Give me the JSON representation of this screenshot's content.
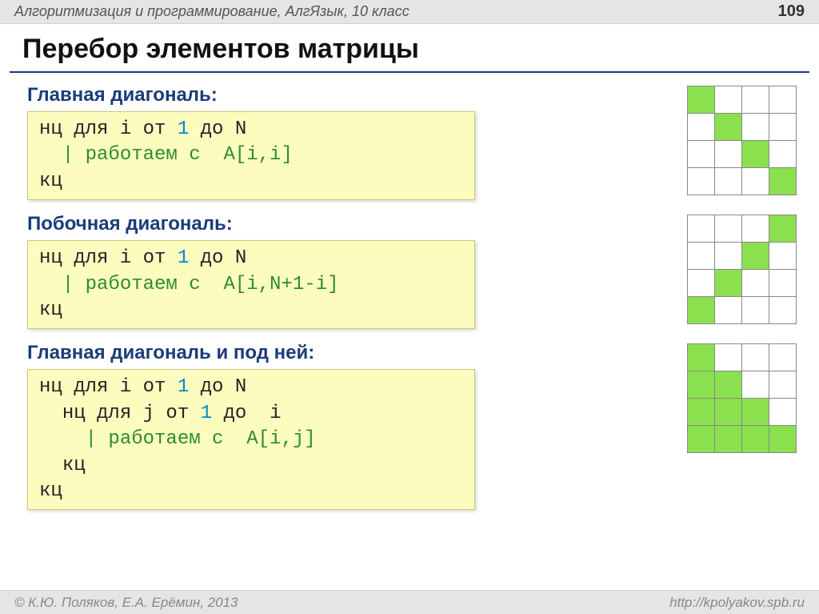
{
  "header": {
    "subject": "Алгоритмизация и программирование, АлгЯзык, 10 класс",
    "page_number": "109"
  },
  "title": "Перебор элементов матрицы",
  "code": {
    "loop_start_i": "нц для i от",
    "loop_start_j": "нц для j от",
    "one": "1",
    "to_N": "до N",
    "to_i": "до  i",
    "loop_end": "кц"
  },
  "sections": [
    {
      "heading": "Главная диагональ:",
      "comment": "| работаем с  A[i,i]",
      "grid": [
        [
          1,
          0,
          0,
          0
        ],
        [
          0,
          1,
          0,
          0
        ],
        [
          0,
          0,
          1,
          0
        ],
        [
          0,
          0,
          0,
          1
        ]
      ]
    },
    {
      "heading": "Побочная диагональ:",
      "comment": "| работаем с  A[i,N+1-i]",
      "grid": [
        [
          0,
          0,
          0,
          1
        ],
        [
          0,
          0,
          1,
          0
        ],
        [
          0,
          1,
          0,
          0
        ],
        [
          1,
          0,
          0,
          0
        ]
      ]
    },
    {
      "heading": "Главная диагональ и под ней:",
      "comment": "| работаем с  A[i,j]",
      "grid": [
        [
          1,
          0,
          0,
          0
        ],
        [
          1,
          1,
          0,
          0
        ],
        [
          1,
          1,
          1,
          0
        ],
        [
          1,
          1,
          1,
          1
        ]
      ]
    }
  ],
  "footer": {
    "copyright": "© К.Ю. Поляков, Е.А. Ерёмин, 2013",
    "url": "http://kpolyakov.spb.ru"
  }
}
